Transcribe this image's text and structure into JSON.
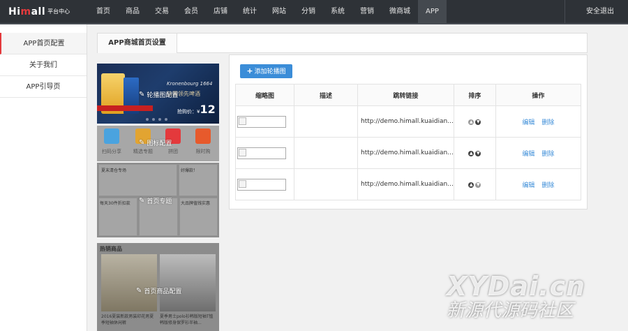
{
  "logo": {
    "main_a": "Hi",
    "main_b": "m",
    "main_c": "all",
    "sub": "平台中心"
  },
  "nav": [
    "首页",
    "商品",
    "交易",
    "会员",
    "店铺",
    "统计",
    "网站",
    "分销",
    "系统",
    "营销",
    "微商城",
    "APP"
  ],
  "nav_active": "APP",
  "logout": "安全退出",
  "sidebar": [
    "APP首页配置",
    "关于我们",
    "APP引导页"
  ],
  "tab": "APP商城首页设置",
  "preview": {
    "banner_brand": "Kronenbourg 1664",
    "banner_title": "法国领先啤酒",
    "banner_price_label": "抢购价：¥",
    "banner_price": "12",
    "icon_labels": [
      "扫码分享",
      "精选专题",
      "拼团",
      "限时购"
    ],
    "topic_texts": [
      "夏末清仓专场",
      "好爆款！",
      "每天30件折扣款",
      "大品牌值钱实惠"
    ],
    "hot_header": "热销商品",
    "hot_caps": [
      "2016夏装新款男装印花男夏季短袖休闲裤",
      "夏季男士polo衫韩版短袖T恤韩版修身保罗衫半袖..."
    ],
    "labels": {
      "banner": "轮播图配置",
      "icons": "图标配置",
      "topic": "首页专题",
      "hot": "首页商品配置"
    }
  },
  "panel": {
    "add_button": "添加轮播图",
    "columns": [
      "缩略图",
      "描述",
      "跳转链接",
      "排序",
      "操作"
    ],
    "rows": [
      {
        "desc": "",
        "link": "http://demo.himall.kuaidian...",
        "edit": "编辑",
        "del": "删除"
      },
      {
        "desc": "",
        "link": "http://demo.himall.kuaidian...",
        "edit": "编辑",
        "del": "删除"
      },
      {
        "desc": "",
        "link": "http://demo.himall.kuaidian...",
        "edit": "编辑",
        "del": "删除"
      }
    ]
  },
  "watermark": {
    "line1": "XYDai.cn",
    "line2": "新源代源码社区"
  },
  "colors": {
    "topbar": "#2e3237",
    "accent": "#3b8dd8",
    "active_tab": "#e4393c"
  }
}
